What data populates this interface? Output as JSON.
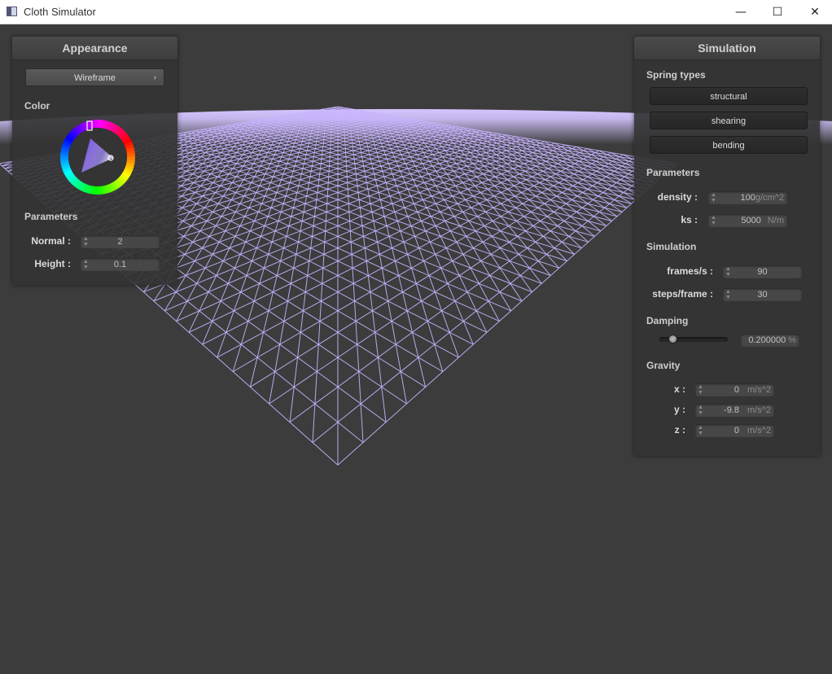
{
  "window": {
    "title": "Cloth Simulator",
    "minimize_glyph": "—",
    "maximize_glyph": "☐",
    "close_glyph": "✕"
  },
  "colors": {
    "cloth": "#d4c4ff",
    "wire": "#c8b4ff",
    "background": "#3c3c3c",
    "panel": "#343434"
  },
  "appearance": {
    "title": "Appearance",
    "shader_button": "Wireframe",
    "shader_chevron": "›",
    "color_label": "Color",
    "parameters_label": "Parameters",
    "normal_label": "Normal :",
    "normal_value": "2",
    "height_label": "Height :",
    "height_value": "0.1"
  },
  "simulation": {
    "title": "Simulation",
    "spring_types_label": "Spring types",
    "structural_button": "structural",
    "shearing_button": "shearing",
    "bending_button": "bending",
    "parameters_label": "Parameters",
    "density_label": "density :",
    "density_value": "100",
    "density_unit": "g/cm^2",
    "ks_label": "ks :",
    "ks_value": "5000",
    "ks_unit": "N/m",
    "simulation_label": "Simulation",
    "fps_label": "frames/s :",
    "fps_value": "90",
    "steps_label": "steps/frame :",
    "steps_value": "30",
    "damping_label": "Damping",
    "damping_slider_fraction": 0.2,
    "damping_value": "0.200000",
    "damping_unit": "%",
    "gravity_label": "Gravity",
    "gx_label": "x :",
    "gx_value": "0",
    "gy_label": "y :",
    "gy_value": "-9.8",
    "gz_label": "z :",
    "gz_value": "0",
    "gravity_unit": "m/s^2"
  }
}
